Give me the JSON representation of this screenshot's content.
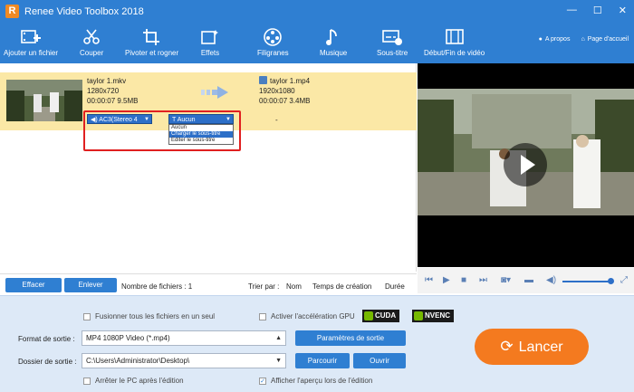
{
  "window": {
    "title": "Renee Video Toolbox 2018",
    "controls": [
      "—",
      "☐",
      "✕"
    ]
  },
  "toolbar": {
    "items": [
      {
        "label": "Ajouter un fichier",
        "icon": "add-file-icon"
      },
      {
        "label": "Couper",
        "icon": "scissors-icon"
      },
      {
        "label": "Pivoter et rogner",
        "icon": "rotate-crop-icon"
      },
      {
        "label": "Effets",
        "icon": "effects-icon"
      },
      {
        "label": "Filigranes",
        "icon": "watermark-icon"
      },
      {
        "label": "Musique",
        "icon": "music-icon"
      },
      {
        "label": "Sous-titre",
        "icon": "subtitle-icon"
      },
      {
        "label": "Début/Fin de vidéo",
        "icon": "intro-outro-icon"
      }
    ],
    "about": "A propos",
    "home": "Page d'accueil"
  },
  "file": {
    "source_name": "taylor 1.mkv",
    "source_resolution": "1280x720",
    "source_duration_size": "00:00:07  9.5MB",
    "output_name": "taylor 1.mp4",
    "output_resolution": "1920x1080",
    "output_duration_size": "00:00:07  3.4MB",
    "audio_track": "AC3(Stereo 4",
    "subtitle_selected": "Aucun",
    "dash": "-",
    "subtitle_options": [
      "Aucun",
      "Charger le sous-titre",
      "Editer le sous-titre"
    ]
  },
  "actions": {
    "clear_label": "Effacer",
    "remove_label": "Enlever",
    "file_count": "Nombre de fichiers : 1",
    "sort_label": "Trier par :",
    "sort_name": "Nom",
    "sort_created": "Temps de création",
    "sort_duration": "Durée"
  },
  "settings": {
    "merge_label": "Fusionner tous les fichiers en un seul",
    "gpu_label": "Activer l'accélération GPU",
    "cuda": "CUDA",
    "nvenc": "NVENC",
    "format_label": "Format de sortie :",
    "format_value": "MP4 1080P Video (*.mp4)",
    "params_button": "Paramètres de sortie",
    "folder_label": "Dossier de sortie :",
    "folder_value": "C:\\Users\\Administrator\\Desktop\\",
    "browse_button": "Parcourir",
    "open_button": "Ouvrir",
    "shutdown_label": "Arrêter le PC après l'édition",
    "preview_label": "Afficher l'aperçu lors de l'édition",
    "preview_checked": true,
    "start_button": "Lancer"
  },
  "colors": {
    "accent": "#2f7fd2",
    "file_row": "#fbe8a6",
    "start": "#f47a1f",
    "highlight": "#e02020"
  }
}
